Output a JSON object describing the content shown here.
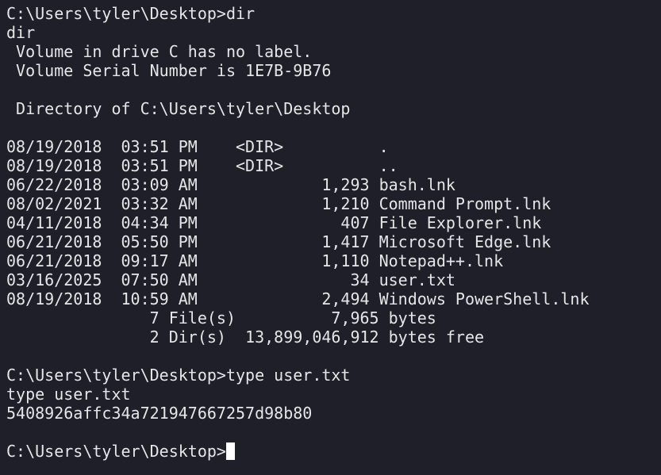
{
  "terminal": {
    "lines": [
      "C:\\Users\\tyler\\Desktop>dir",
      "dir",
      " Volume in drive C has no label.",
      " Volume Serial Number is 1E7B-9B76",
      "",
      " Directory of C:\\Users\\tyler\\Desktop",
      "",
      "08/19/2018  03:51 PM    <DIR>          .",
      "08/19/2018  03:51 PM    <DIR>          ..",
      "06/22/2018  03:09 AM             1,293 bash.lnk",
      "08/02/2021  03:32 AM             1,210 Command Prompt.lnk",
      "04/11/2018  04:34 PM               407 File Explorer.lnk",
      "06/21/2018  05:50 PM             1,417 Microsoft Edge.lnk",
      "06/21/2018  09:17 AM             1,110 Notepad++.lnk",
      "03/16/2025  07:50 AM                34 user.txt",
      "08/19/2018  10:59 AM             2,494 Windows PowerShell.lnk",
      "               7 File(s)          7,965 bytes",
      "               2 Dir(s)  13,899,046,912 bytes free",
      "",
      "C:\\Users\\tyler\\Desktop>type user.txt",
      "type user.txt",
      "5408926affc34a721947667257d98b80",
      "",
      "C:\\Users\\tyler\\Desktop>"
    ],
    "colors": {
      "background": "#1e1f29",
      "foreground": "#e6e6e6",
      "cursor": "#ffffff"
    }
  }
}
